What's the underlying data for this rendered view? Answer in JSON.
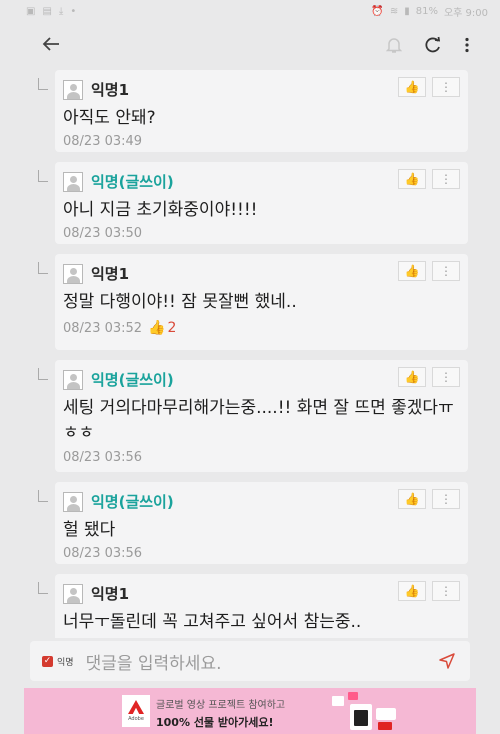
{
  "statusbar": {
    "battery": "81%",
    "time": "오후 9:00"
  },
  "comments": [
    {
      "author": "익명1",
      "is_writer": false,
      "text": "아직도 안돼?",
      "date": "08/23 03:49",
      "likes": ""
    },
    {
      "author": "익명(글쓰이)",
      "is_writer": true,
      "text": "아니 지금 초기화중이야!!!!",
      "date": "08/23 03:50",
      "likes": ""
    },
    {
      "author": "익명1",
      "is_writer": false,
      "text": "정말 다행이야!! 잠 못잘뻔 했네..",
      "date": "08/23 03:52",
      "likes": "2"
    },
    {
      "author": "익명(글쓰이)",
      "is_writer": true,
      "text": "세팅 거의다마무리해가는중....!! 화면 잘 뜨면 좋겠다ㅠㅎㅎ",
      "date": "08/23 03:56",
      "likes": ""
    },
    {
      "author": "익명(글쓰이)",
      "is_writer": true,
      "text": "헐 됐다",
      "date": "08/23 03:56",
      "likes": ""
    },
    {
      "author": "익명1",
      "is_writer": false,
      "text": "너무ㅜ돌린데 꼭 고쳐주고 싶어서 참는중..",
      "date": "",
      "likes": ""
    }
  ],
  "input": {
    "anonymous_label": "익명",
    "placeholder": "댓글을 입력하세요."
  },
  "ad": {
    "brand": "Adobe",
    "line1": "글로벌 영상 프로젝트 참여하고",
    "line2": "100% 선물 받아가세요!"
  },
  "colors": {
    "writer": "#1aa39c",
    "accent": "#d94a3a"
  }
}
